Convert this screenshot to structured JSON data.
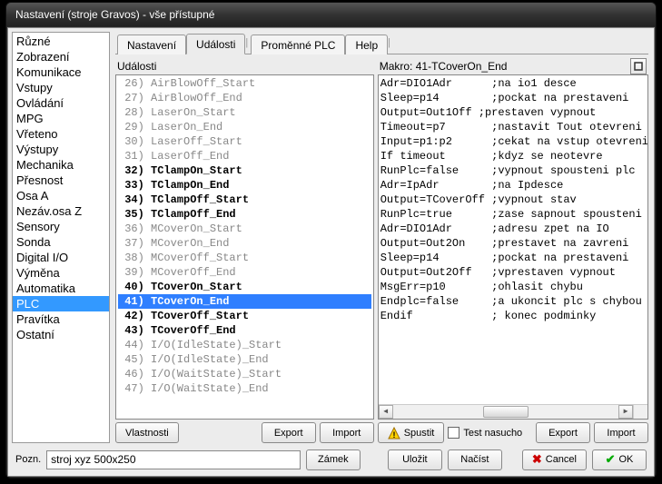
{
  "window": {
    "title": "Nastavení (stroje Gravos) - vše přístupné"
  },
  "sidebar": {
    "items": [
      {
        "label": "Různé"
      },
      {
        "label": "Zobrazení"
      },
      {
        "label": "Komunikace"
      },
      {
        "label": "Vstupy"
      },
      {
        "label": "Ovládání"
      },
      {
        "label": "MPG"
      },
      {
        "label": "Vřeteno"
      },
      {
        "label": "Výstupy"
      },
      {
        "label": "Mechanika"
      },
      {
        "label": "Přesnost"
      },
      {
        "label": "Osa A"
      },
      {
        "label": "Nezáv.osa Z"
      },
      {
        "label": "Sensory"
      },
      {
        "label": "Sonda"
      },
      {
        "label": "Digital I/O"
      },
      {
        "label": "Výměna"
      },
      {
        "label": "Automatika"
      },
      {
        "label": "PLC"
      },
      {
        "label": "Pravítka"
      },
      {
        "label": "Ostatní"
      }
    ],
    "selected_index": 17
  },
  "tabs": {
    "items": [
      "Nastavení",
      "Události",
      "Proměnné PLC",
      "Help"
    ],
    "active_index": 1
  },
  "events": {
    "header": "Události",
    "rows": [
      {
        "n": 26,
        "label": "AirBlowOff_Start",
        "bold": false
      },
      {
        "n": 27,
        "label": "AirBlowOff_End",
        "bold": false
      },
      {
        "n": 28,
        "label": "LaserOn_Start",
        "bold": false
      },
      {
        "n": 29,
        "label": "LaserOn_End",
        "bold": false
      },
      {
        "n": 30,
        "label": "LaserOff_Start",
        "bold": false
      },
      {
        "n": 31,
        "label": "LaserOff_End",
        "bold": false
      },
      {
        "n": 32,
        "label": "TClampOn_Start",
        "bold": true
      },
      {
        "n": 33,
        "label": "TClampOn_End",
        "bold": true
      },
      {
        "n": 34,
        "label": "TClampOff_Start",
        "bold": true
      },
      {
        "n": 35,
        "label": "TClampOff_End",
        "bold": true
      },
      {
        "n": 36,
        "label": "MCoverOn_Start",
        "bold": false
      },
      {
        "n": 37,
        "label": "MCoverOn_End",
        "bold": false
      },
      {
        "n": 38,
        "label": "MCoverOff_Start",
        "bold": false
      },
      {
        "n": 39,
        "label": "MCoverOff_End",
        "bold": false
      },
      {
        "n": 40,
        "label": "TCoverOn_Start",
        "bold": true
      },
      {
        "n": 41,
        "label": "TCoverOn_End",
        "bold": true,
        "selected": true
      },
      {
        "n": 42,
        "label": "TCoverOff_Start",
        "bold": true
      },
      {
        "n": 43,
        "label": "TCoverOff_End",
        "bold": true
      },
      {
        "n": 44,
        "label": "I/O(IdleState)_Start",
        "bold": false
      },
      {
        "n": 45,
        "label": "I/O(IdleState)_End",
        "bold": false
      },
      {
        "n": 46,
        "label": "I/O(WaitState)_Start",
        "bold": false
      },
      {
        "n": 47,
        "label": "I/O(WaitState)_End",
        "bold": false
      }
    ],
    "buttons": {
      "properties": "Vlastnosti",
      "export": "Export",
      "import": "Import"
    }
  },
  "macro": {
    "header": "Makro: 41-TCoverOn_End",
    "code": [
      "Adr=DIO1Adr      ;na io1 desce",
      "Sleep=p14        ;pockat na prestaveni",
      "Output=Out1Off ;prestaven vypnout",
      "Timeout=p7       ;nastavit Tout otevreni",
      "Input=p1:p2      ;cekat na vstup otevreni",
      "If timeout       ;kdyz se neotevre",
      "RunPlc=false     ;vypnout spousteni plc",
      "Adr=IpAdr        ;na Ipdesce",
      "Output=TCoverOff ;vypnout stav",
      "RunPlc=true      ;zase sapnout spousteni",
      "Adr=DIO1Adr      ;adresu zpet na IO",
      "Output=Out2On    ;prestavet na zavreni",
      "Sleep=p14        ;pockat na prestaveni",
      "Output=Out2Off   ;vprestaven vypnout",
      "MsgErr=p10       ;ohlasit chybu",
      "Endplc=false     ;a ukoncit plc s chybou",
      "Endif            ; konec podminky"
    ],
    "buttons": {
      "run": "Spustit",
      "dryrun": "Test nasucho",
      "export": "Export",
      "import": "Import"
    }
  },
  "footer": {
    "note_label": "Pozn.",
    "note_value": "stroj xyz 500x250",
    "lock": "Zámek",
    "save": "Uložit",
    "load": "Načíst",
    "cancel": "Cancel",
    "ok": "OK"
  }
}
